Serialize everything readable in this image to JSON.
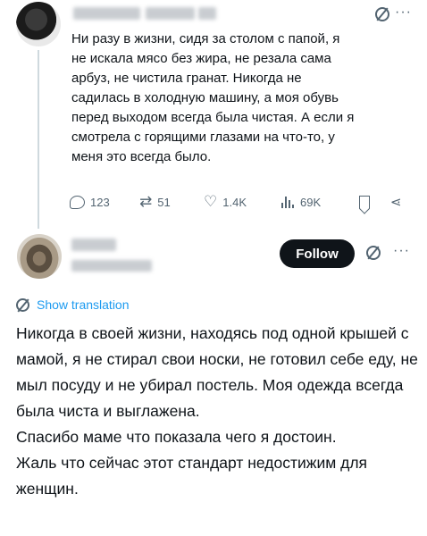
{
  "post1": {
    "text_lines": [
      "Ни разу в жизни, сидя за столом с папой, я",
      "не искала мясо без жира, не резала сама",
      "арбуз, не чистила гранат. Никогда не",
      "садилась в холодную машину, а моя обувь",
      "перед выходом всегда была чистая. А если я",
      "смотрела с горящими глазами на что-то, у",
      "меня это всегда было."
    ],
    "stats": {
      "replies": "123",
      "reposts": "51",
      "likes": "1.4K",
      "views": "69K"
    },
    "more_label": "···"
  },
  "post2": {
    "follow_label": "Follow",
    "more_label": "···",
    "show_translation": "Show translation",
    "paragraphs": [
      "Никогда в своей жизни, находясь под одной крышей с мамой, я не стирал свои носки, не готовил себе еду, не мыл посуду и не убирал постель. Моя одежда всегда была чиста и выглажена.",
      "Спасибо маме что показала чего я достоин.",
      "Жаль что сейчас этот стандарт недостижим для женщин."
    ]
  },
  "colors": {
    "text": "#0f1419",
    "muted": "#536471",
    "link": "#1d9bf0",
    "follow_bg": "#0f1419"
  },
  "icons": [
    "reply-icon",
    "repost-icon",
    "like-icon",
    "views-icon",
    "bookmark-icon",
    "share-icon",
    "translate-icon",
    "more-icon"
  ]
}
